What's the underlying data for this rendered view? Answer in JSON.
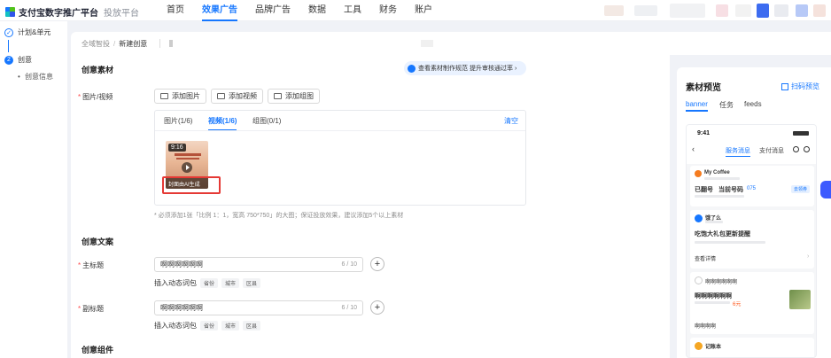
{
  "header": {
    "brand": "支付宝数字推广平台",
    "platform": "投放平台",
    "nav": [
      "首页",
      "效果广告",
      "品牌广告",
      "数据",
      "工具",
      "财务",
      "账户"
    ],
    "active_nav_index": 1
  },
  "sidebar": {
    "steps": [
      {
        "marker": "✓",
        "label": "计划&单元"
      },
      {
        "marker": "2",
        "label": "创意"
      }
    ],
    "sub": "创意信息"
  },
  "breadcrumb": {
    "root": "全域智投",
    "current": "新建创意"
  },
  "creative_material": {
    "title": "创意素材",
    "tip": "查看素材制作规范 提升审核通过率",
    "label": "图片/视频",
    "buttons": {
      "image": "添加图片",
      "video": "添加视频",
      "group": "添加组图"
    },
    "tabs": [
      "图片(1/6)",
      "视频(1/6)",
      "组图(0/1)"
    ],
    "active_tab": 1,
    "clear": "清空",
    "thumb": {
      "duration": "9:16",
      "bar": "封面由AI生成"
    },
    "hint": "* 必须添加1张「比例 1：1，宽高 750*750」的大图；保证投放效果，建议添加5个以上素材"
  },
  "creative_copy": {
    "title": "创意文案",
    "main_label": "主标题",
    "main_value": "啊啊啊啊啊啊",
    "main_count": "6 / 10",
    "sub_label": "副标题",
    "sub_value": "啊啊啊啊啊啊",
    "sub_count": "6 / 10",
    "dynamic_label": "插入动态词包",
    "dynamic_tags": [
      "省份",
      "城市",
      "区县"
    ]
  },
  "creative_component": {
    "title": "创意组件"
  },
  "preview": {
    "title": "素材预览",
    "action": "扫码预览",
    "tabs": [
      "banner",
      "任务",
      "feeds"
    ],
    "phone": {
      "time": "9:41",
      "tabs": [
        "服务消息",
        "支付消息"
      ],
      "card1": {
        "brand": "My Coffee",
        "stats": [
          "已翻号",
          "当前号码",
          "075"
        ],
        "tag": "去领券"
      },
      "card2": {
        "brand": "饿了么",
        "title": "吃饱大礼包更新提醒",
        "link": "查看详情"
      },
      "card3": {
        "head": "啊啊啊啊啊啊",
        "title": "啊啊啊啊啊啊",
        "price": "6元",
        "foot": "啊啊啊啊"
      },
      "card4": {
        "brand": "记账本"
      }
    }
  },
  "colors": {
    "accent": "#1677ff",
    "highlight": "#e53935",
    "required": "#ff4d4f"
  }
}
